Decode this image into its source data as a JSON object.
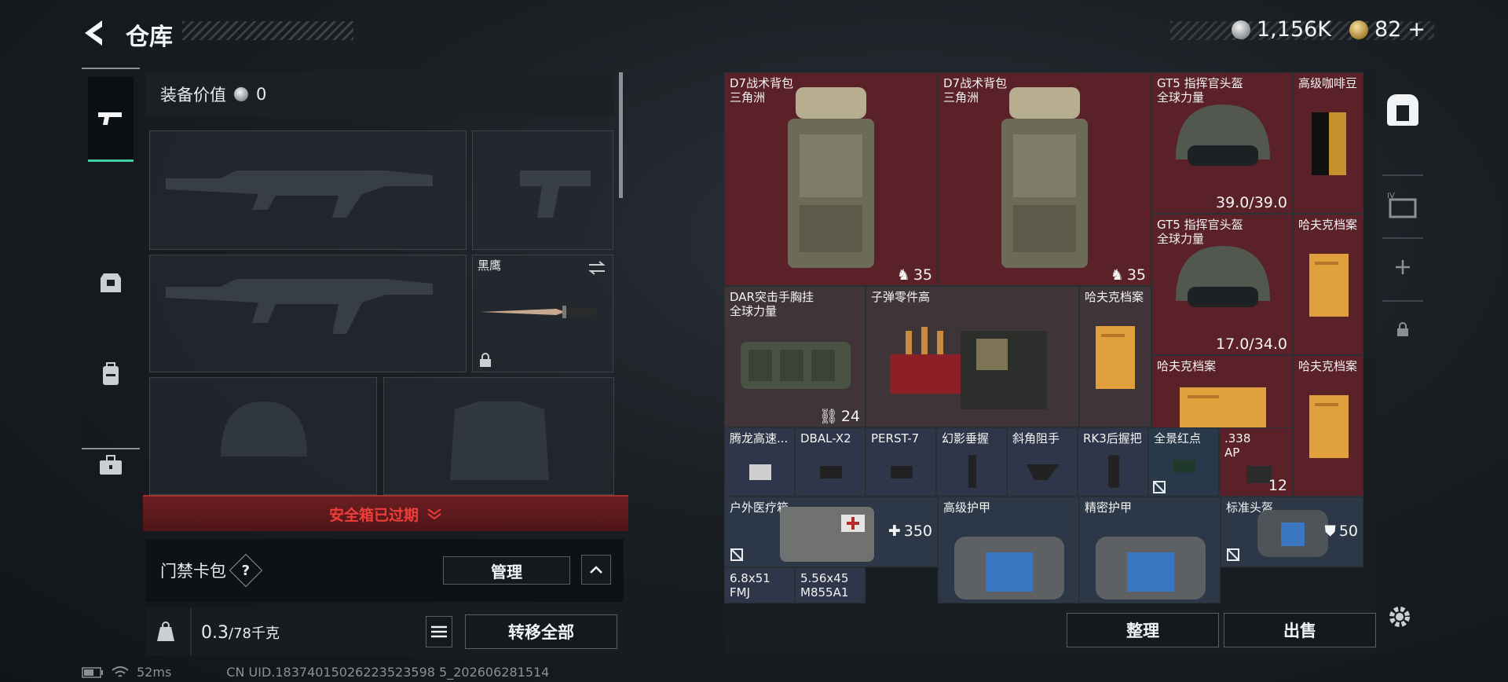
{
  "header": {
    "title": "仓库",
    "silver_amount": "1,156K",
    "gold_amount": "82",
    "gold_plus": "+"
  },
  "tabs": [
    {
      "name": "weapons"
    },
    {
      "name": "armor"
    },
    {
      "name": "backpack"
    },
    {
      "name": "toolbox"
    }
  ],
  "loadout": {
    "value_label": "装备价值",
    "value": "0",
    "melee_label": "黑鹰",
    "safe_box": "安全箱已过期",
    "card_label": "门禁卡包",
    "card_help": "?",
    "manage": "管理",
    "weight_current": "0.3",
    "weight_max": "/78千克",
    "transfer_all": "转移全部"
  },
  "status": {
    "ping": "52ms",
    "uid": "CN UID.18374015026223523598 5_202606281514"
  },
  "stash": {
    "items": [
      {
        "id": "bp1",
        "name": "D7战术背包",
        "sub": "三角洲",
        "count": "35"
      },
      {
        "id": "bp2",
        "name": "D7战术背包",
        "sub": "三角洲",
        "count": "35"
      },
      {
        "id": "helm1",
        "name": "GT5 指挥官头盔",
        "sub": "全球力量",
        "count": "39.0/39.0"
      },
      {
        "id": "coffee",
        "name": "高级咖啡豆"
      },
      {
        "id": "helm2",
        "name": "GT5 指挥官头盔",
        "sub": "全球力量",
        "count": "17.0/34.0"
      },
      {
        "id": "hafk1",
        "name": "哈夫克档案"
      },
      {
        "id": "rig",
        "name": "DAR突击手胸挂",
        "sub": "全球力量",
        "count": "24"
      },
      {
        "id": "ammo",
        "name": "子弹零件高"
      },
      {
        "id": "hafk2",
        "name": "哈夫克档案"
      },
      {
        "id": "hafk3",
        "name": "哈夫克档案"
      },
      {
        "id": "hafk4",
        "name": "哈夫克档案"
      },
      {
        "id": "a1",
        "name": "腾龙高速..."
      },
      {
        "id": "a2",
        "name": "DBAL-X2"
      },
      {
        "id": "a3",
        "name": "PERST-7"
      },
      {
        "id": "a4",
        "name": "幻影垂握"
      },
      {
        "id": "a5",
        "name": "斜角阻手"
      },
      {
        "id": "a6",
        "name": "RK3后握把"
      },
      {
        "id": "a7",
        "name": "全景红点"
      },
      {
        "id": "a8",
        "name": ".338",
        "sub": "AP",
        "count": "12"
      },
      {
        "id": "med",
        "name": "户外医疗箱",
        "count": "350"
      },
      {
        "id": "arm1",
        "name": "高级护甲"
      },
      {
        "id": "arm2",
        "name": "精密护甲"
      },
      {
        "id": "helm3",
        "name": "标准头盔",
        "count": "50"
      },
      {
        "id": "r1",
        "name": "6.8x51",
        "sub": "FMJ"
      },
      {
        "id": "r2",
        "name": "5.56x45",
        "sub": "M855A1"
      }
    ],
    "sort": "整理",
    "sell": "出售"
  }
}
